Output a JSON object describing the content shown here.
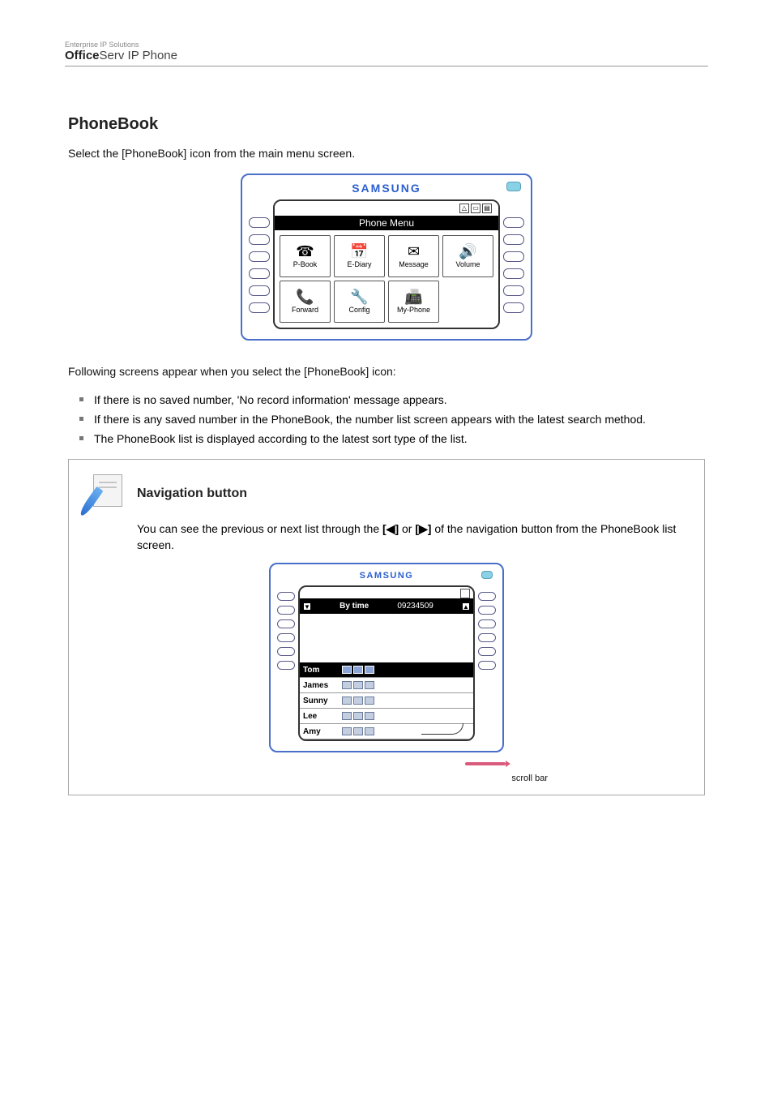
{
  "header": {
    "tagline": "Enterprise IP Solutions",
    "product_bold": "Office",
    "product_rest": "Serv IP Phone"
  },
  "section": {
    "title": "PhoneBook",
    "intro": "Select the [PhoneBook] icon from the main menu screen."
  },
  "phone_main": {
    "brand": "SAMSUNG",
    "title_bar": "Phone Menu",
    "icons": [
      {
        "label": "P-Book",
        "glyph": "☎"
      },
      {
        "label": "E-Diary",
        "glyph": "📅"
      },
      {
        "label": "Message",
        "glyph": "✉"
      },
      {
        "label": "Volume",
        "glyph": "🔊"
      },
      {
        "label": "Forward",
        "glyph": "📞"
      },
      {
        "label": "Config",
        "glyph": "🔧"
      },
      {
        "label": "My-Phone",
        "glyph": "📠"
      }
    ]
  },
  "notes": {
    "after_image": "Following screens appear when you select the [PhoneBook] icon:",
    "bullets": [
      "If there is no saved number, 'No record information' message appears.",
      "If there is any saved number in the PhoneBook, the number list screen appears with the latest search method.",
      "The PhoneBook list is displayed according to the latest sort type of the list."
    ]
  },
  "note_box": {
    "heading": "Navigation button",
    "body_pre": "You can see the previous or next list through the ",
    "btn_left": "[◀]",
    "body_mid": " or ",
    "btn_right": "[▶]",
    "body_post": " of the navigation button from the PhoneBook list screen.",
    "scroll_label": "scroll bar"
  },
  "phone_pb": {
    "brand": "SAMSUNG",
    "header": {
      "left": "▼",
      "mid": "By time",
      "right_text": "09234509",
      "right": "▲"
    },
    "rows": [
      {
        "name": "Tom",
        "selected": true
      },
      {
        "name": "James",
        "selected": false
      },
      {
        "name": "Sunny",
        "selected": false
      },
      {
        "name": "Lee",
        "selected": false
      },
      {
        "name": "Amy",
        "selected": false
      }
    ]
  }
}
